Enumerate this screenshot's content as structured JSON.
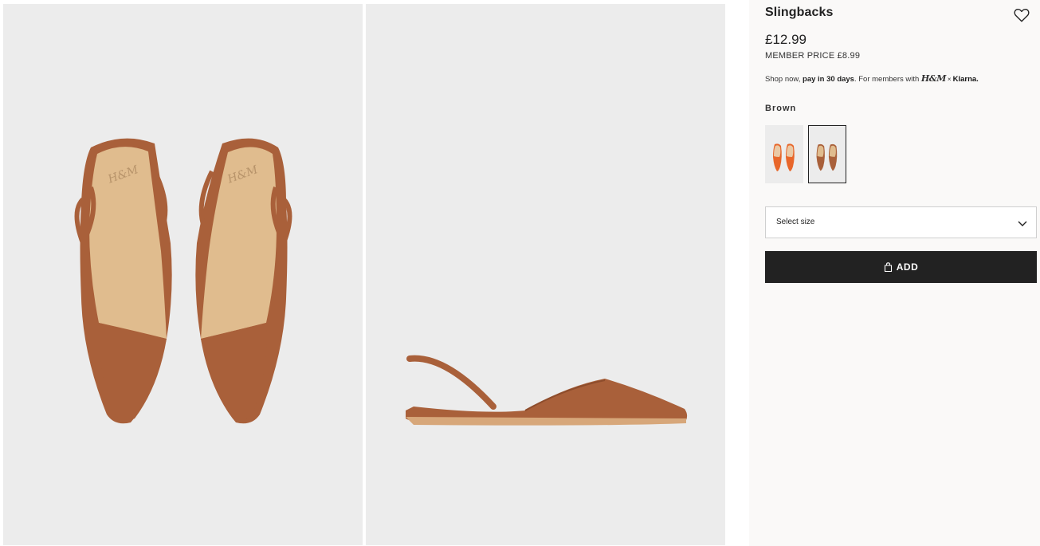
{
  "product": {
    "title": "Slingbacks",
    "price": "£12.99",
    "member_price": "MEMBER PRICE £8.99"
  },
  "klarna": {
    "prefix": "Shop now, ",
    "emphasis": "pay in 30 days",
    "middle": ". For members with ",
    "hm_logo": "H&M",
    "separator": "×",
    "brand": "Klarna."
  },
  "color": {
    "label": "Brown",
    "swatches": [
      {
        "name": "Orange",
        "color": "#e8662a"
      },
      {
        "name": "Brown",
        "color": "#a9603a",
        "selected": true
      }
    ]
  },
  "size": {
    "placeholder": "Select size"
  },
  "add_button": {
    "label": "ADD"
  },
  "images": [
    {
      "brand_mark": "H&M",
      "view": "top"
    },
    {
      "view": "side"
    }
  ],
  "icons": [
    "heart-icon",
    "chevron-down-icon",
    "shopping-bag-icon"
  ],
  "colors": {
    "shoe": "#a9603a",
    "insole": "#e0bc8e",
    "button_bg": "#222222",
    "panel_bg": "#faf9f8",
    "photo_bg": "#ececec"
  }
}
